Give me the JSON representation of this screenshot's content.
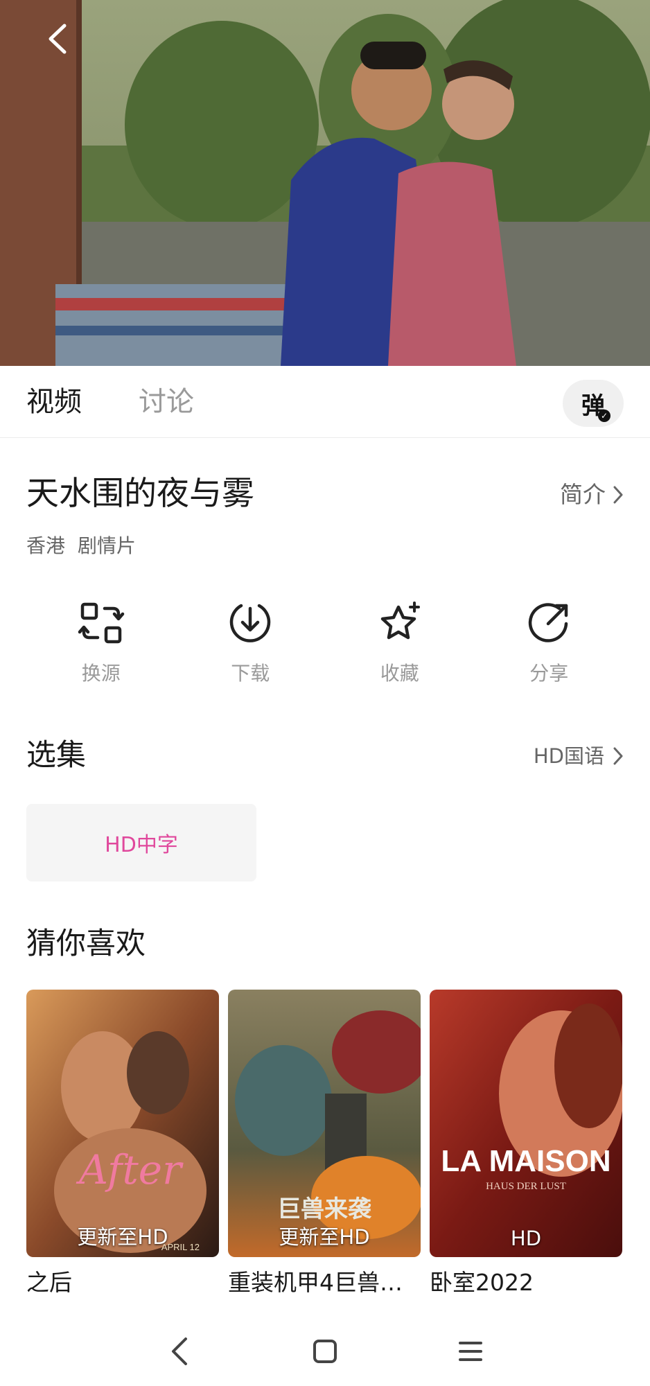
{
  "tabs": {
    "video": "视频",
    "discussion": "讨论",
    "danmaku": "弹"
  },
  "movie": {
    "title": "天水围的夜与雾",
    "intro_link": "简介",
    "tags": [
      "香港",
      "剧情片"
    ]
  },
  "actions": [
    {
      "label": "换源",
      "icon": "switch-source-icon"
    },
    {
      "label": "下载",
      "icon": "download-icon"
    },
    {
      "label": "收藏",
      "icon": "favorite-star-icon"
    },
    {
      "label": "分享",
      "icon": "share-icon"
    }
  ],
  "episodes": {
    "title": "选集",
    "source_link": "HD国语",
    "items": [
      "HD中字"
    ]
  },
  "recommend": {
    "title": "猜你喜欢",
    "items": [
      {
        "name": "之后",
        "badge": "更新至HD",
        "poster_text": "After",
        "poster_caption": "APRIL 12"
      },
      {
        "name": "重装机甲4巨兽…",
        "badge": "更新至HD",
        "poster_text": "巨兽来袭"
      },
      {
        "name": "卧室2022",
        "badge": "HD",
        "poster_text": "LA MAISON",
        "poster_sub": "HAUS DER LUST"
      }
    ]
  },
  "colors": {
    "accent": "#e0489c",
    "text_primary": "#1a1a1a",
    "text_secondary": "#9a9a9a"
  }
}
